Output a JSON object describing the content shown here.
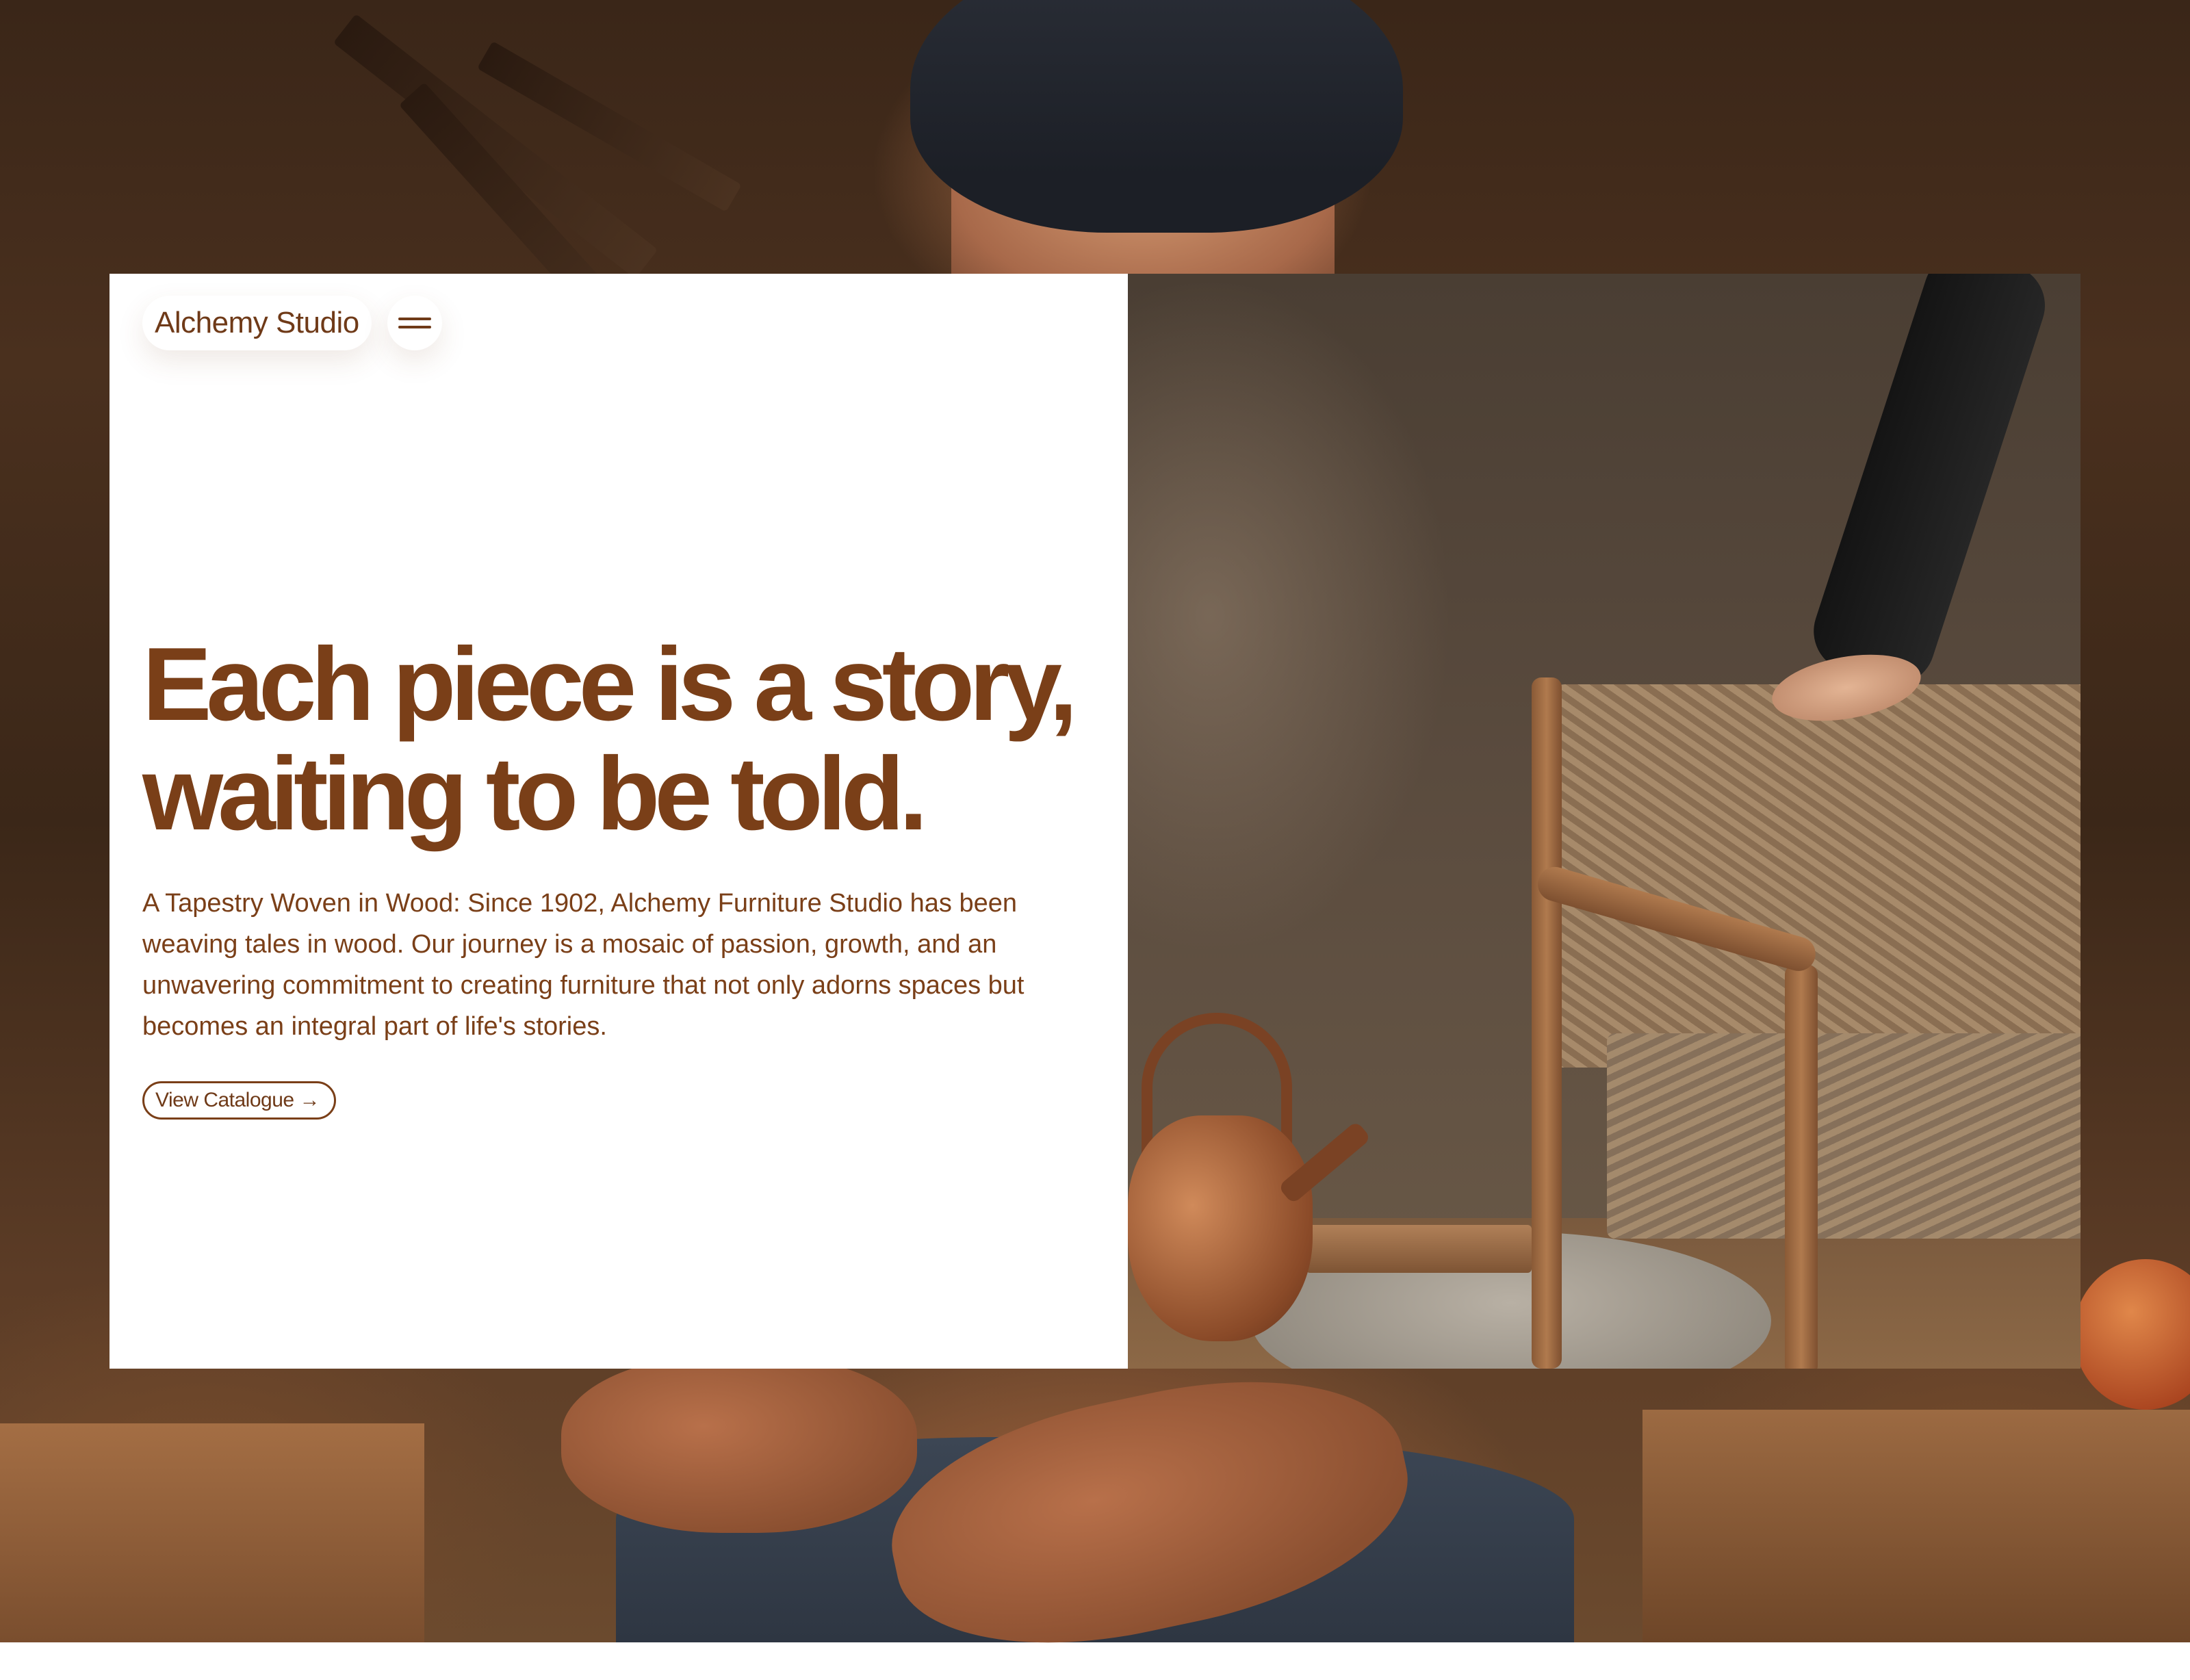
{
  "brand": {
    "name": "Alchemy Studio",
    "menu_icon": "hamburger-menu-icon"
  },
  "hero": {
    "headline_line1": "Each piece is a story,",
    "headline_line2": "waiting to be told.",
    "description": "A Tapestry Woven in Wood: Since 1902, Alchemy Furniture Studio has been weaving tales in wood. Our journey is a mosaic of passion, growth, and an unwavering commitment to creating furniture that not only adorns spaces but becomes an integral part of life's stories.",
    "cta_label": "View Catalogue",
    "cta_icon": "arrow-right-icon",
    "cta_arrow": "→"
  },
  "colors": {
    "accent_brown": "#7a3f18",
    "card_background": "#ffffff"
  }
}
